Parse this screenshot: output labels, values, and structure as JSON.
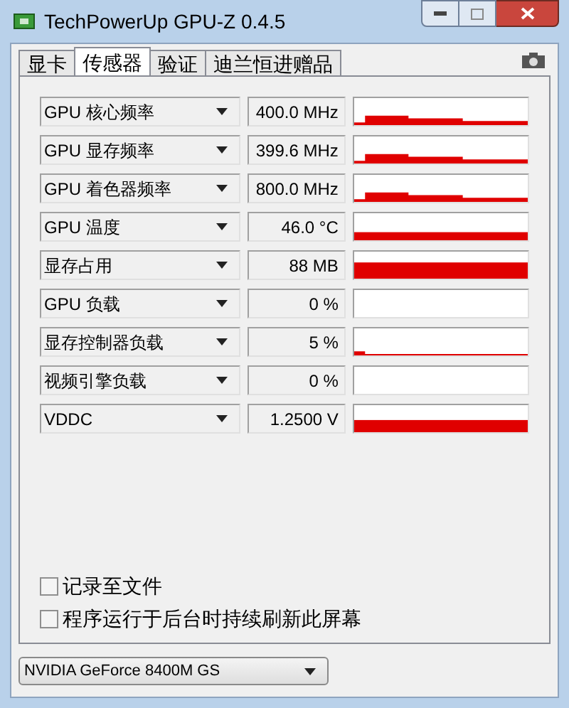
{
  "window": {
    "title": "TechPowerUp GPU-Z 0.4.5"
  },
  "tabs": [
    {
      "label": "显卡",
      "selected": false
    },
    {
      "label": "传感器",
      "selected": true
    },
    {
      "label": "验证",
      "selected": false
    },
    {
      "label": "迪兰恒进赠品",
      "selected": false
    }
  ],
  "sensors": [
    {
      "name": "GPU 核心频率",
      "value": "400.0 MHz",
      "kind": "steps"
    },
    {
      "name": "GPU 显存频率",
      "value": "399.6 MHz",
      "kind": "steps"
    },
    {
      "name": "GPU 着色器频率",
      "value": "800.0 MHz",
      "kind": "steps"
    },
    {
      "name": "GPU 温度",
      "value": "46.0 °C",
      "kind": "low-band"
    },
    {
      "name": "显存占用",
      "value": "88 MB",
      "kind": "high-band"
    },
    {
      "name": "GPU 负载",
      "value": "0 %",
      "kind": "empty"
    },
    {
      "name": "显存控制器负载",
      "value": "5 %",
      "kind": "blip"
    },
    {
      "name": "视频引擎负载",
      "value": "0 %",
      "kind": "empty"
    },
    {
      "name": "VDDC",
      "value": "1.2500 V",
      "kind": "mid-band"
    }
  ],
  "options": [
    {
      "label": "记录至文件",
      "checked": false
    },
    {
      "label": "程序运行于后台时持续刷新此屏幕",
      "checked": false
    }
  ],
  "device_select": {
    "value": "NVIDIA GeForce 8400M GS"
  }
}
